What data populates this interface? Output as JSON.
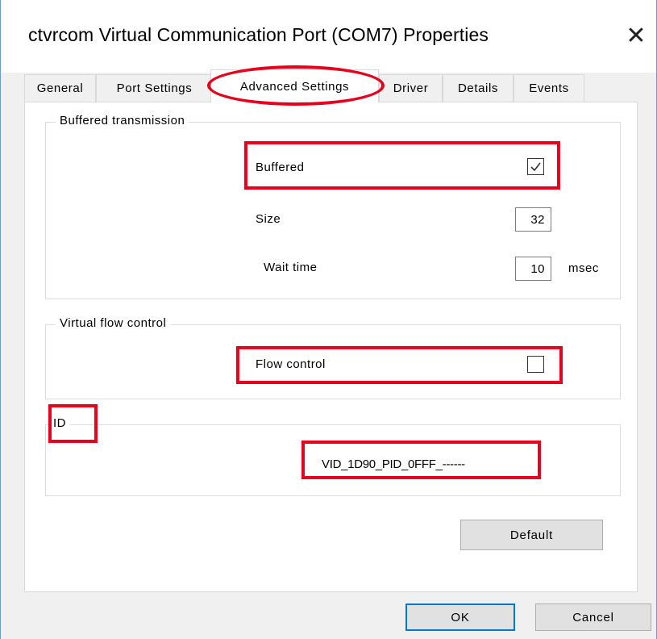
{
  "window": {
    "title": "ctvrcom Virtual Communication Port (COM7) Properties",
    "close_glyph": "✕"
  },
  "tabs": [
    {
      "label": "General"
    },
    {
      "label": "Port Settings"
    },
    {
      "label": "Advanced Settings",
      "active": true
    },
    {
      "label": "Driver"
    },
    {
      "label": "Details"
    },
    {
      "label": "Events"
    }
  ],
  "buffered_transmission": {
    "group_label": "Buffered transmission",
    "buffered_label": "Buffered",
    "buffered_checked": true,
    "size_label": "Size",
    "size_value": "32",
    "wait_time_label": "Wait time",
    "wait_time_value": "10",
    "wait_time_unit": "msec"
  },
  "virtual_flow_control": {
    "group_label": "Virtual flow control",
    "flow_control_label": "Flow control",
    "flow_control_checked": false
  },
  "id_group": {
    "group_label": "ID",
    "id_value": "VID_1D90_PID_0FFF_------"
  },
  "buttons": {
    "default_label": "Default",
    "ok_label": "OK",
    "cancel_label": "Cancel"
  },
  "colors": {
    "annotation": "#e8001c",
    "focus_border": "#0078d7",
    "window_border": "#6b9ad6"
  },
  "icons": {
    "close": "close-icon",
    "check": "checkmark-icon"
  }
}
